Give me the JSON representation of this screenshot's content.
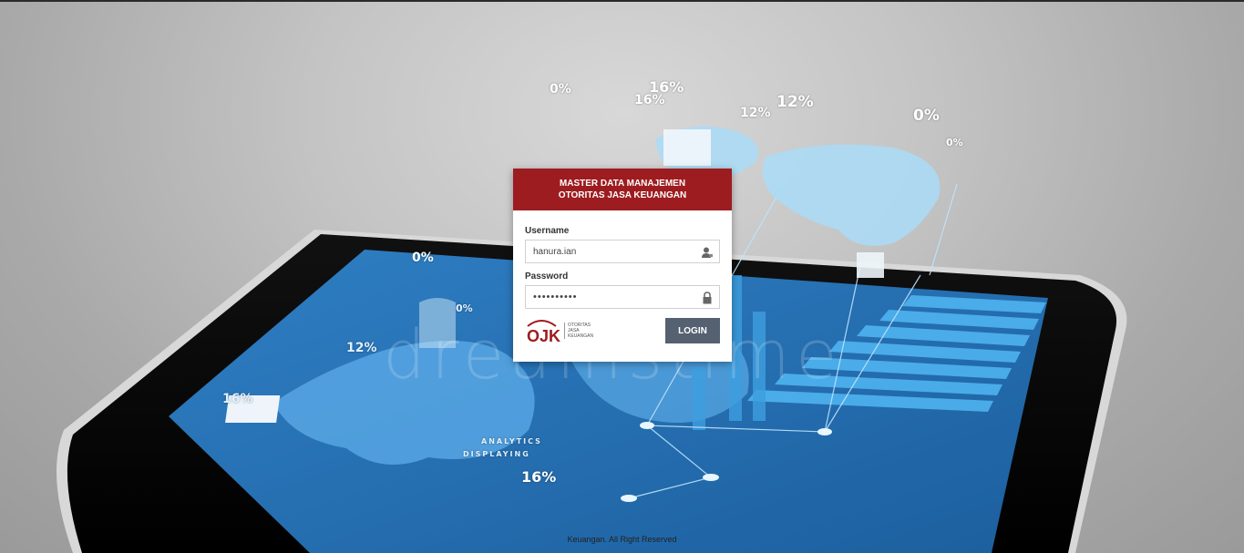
{
  "background": {
    "watermark": "dreamstime",
    "percent_labels": [
      "0%",
      "16%",
      "16%",
      "12%",
      "12%",
      "0%",
      "0%",
      "0%",
      "0%",
      "12%",
      "16%",
      "16%"
    ],
    "tablet_caption_line1": "DISPLAYING",
    "tablet_caption_line2": "ANALYTICS"
  },
  "login": {
    "title_line1": "MASTER DATA MANAJEMEN",
    "title_line2": "OTORITAS JASA KEUANGAN",
    "username_label": "Username",
    "username_value": "hanura.ian",
    "password_label": "Password",
    "password_value": "••••••••••",
    "login_button": "LOGIN",
    "logo_mark": "OJK",
    "logo_text_line1": "OTORITAS",
    "logo_text_line2": "JASA",
    "logo_text_line3": "KEUANGAN"
  },
  "footer": {
    "text": "Keuangan. All Right Reserved"
  },
  "colors": {
    "header_red": "#9d1c20",
    "button_slate": "#556170"
  },
  "icons": {
    "username": "user-icon",
    "password": "lock-icon"
  }
}
